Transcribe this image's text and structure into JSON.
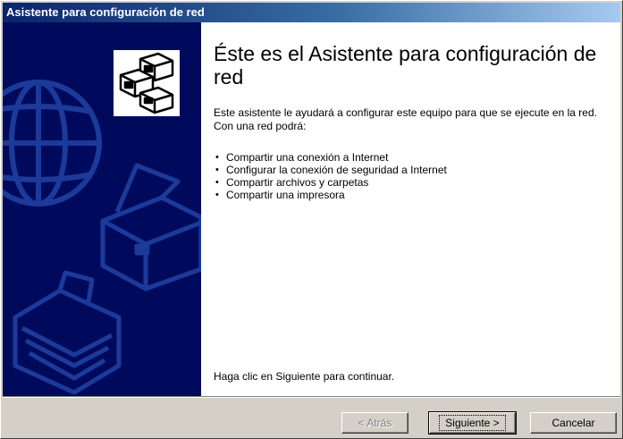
{
  "window": {
    "title": "Asistente para configuración de red"
  },
  "content": {
    "heading": "Éste es el Asistente para configuración de red",
    "intro": "Este asistente le ayudará a configurar este equipo para que se ejecute en la red. Con una red podrá:",
    "bullets": [
      "Compartir una conexión a Internet",
      "Configurar la conexión de seguridad a Internet",
      "Compartir archivos y carpetas",
      "Compartir una impresora"
    ],
    "footer": "Haga clic en Siguiente para continuar."
  },
  "buttons": {
    "back": "< Atrás",
    "next": "Siguiente >",
    "cancel": "Cancelar"
  },
  "icons": {
    "wizard": "network-computers-icon",
    "globe": "globe-icon",
    "printer": "printer-icon",
    "folder": "folder-icon"
  },
  "colors": {
    "title_start": "#0a246a",
    "title_end": "#a6caf0",
    "side_panel": "#000a5c",
    "dialog": "#d4d0c8"
  }
}
